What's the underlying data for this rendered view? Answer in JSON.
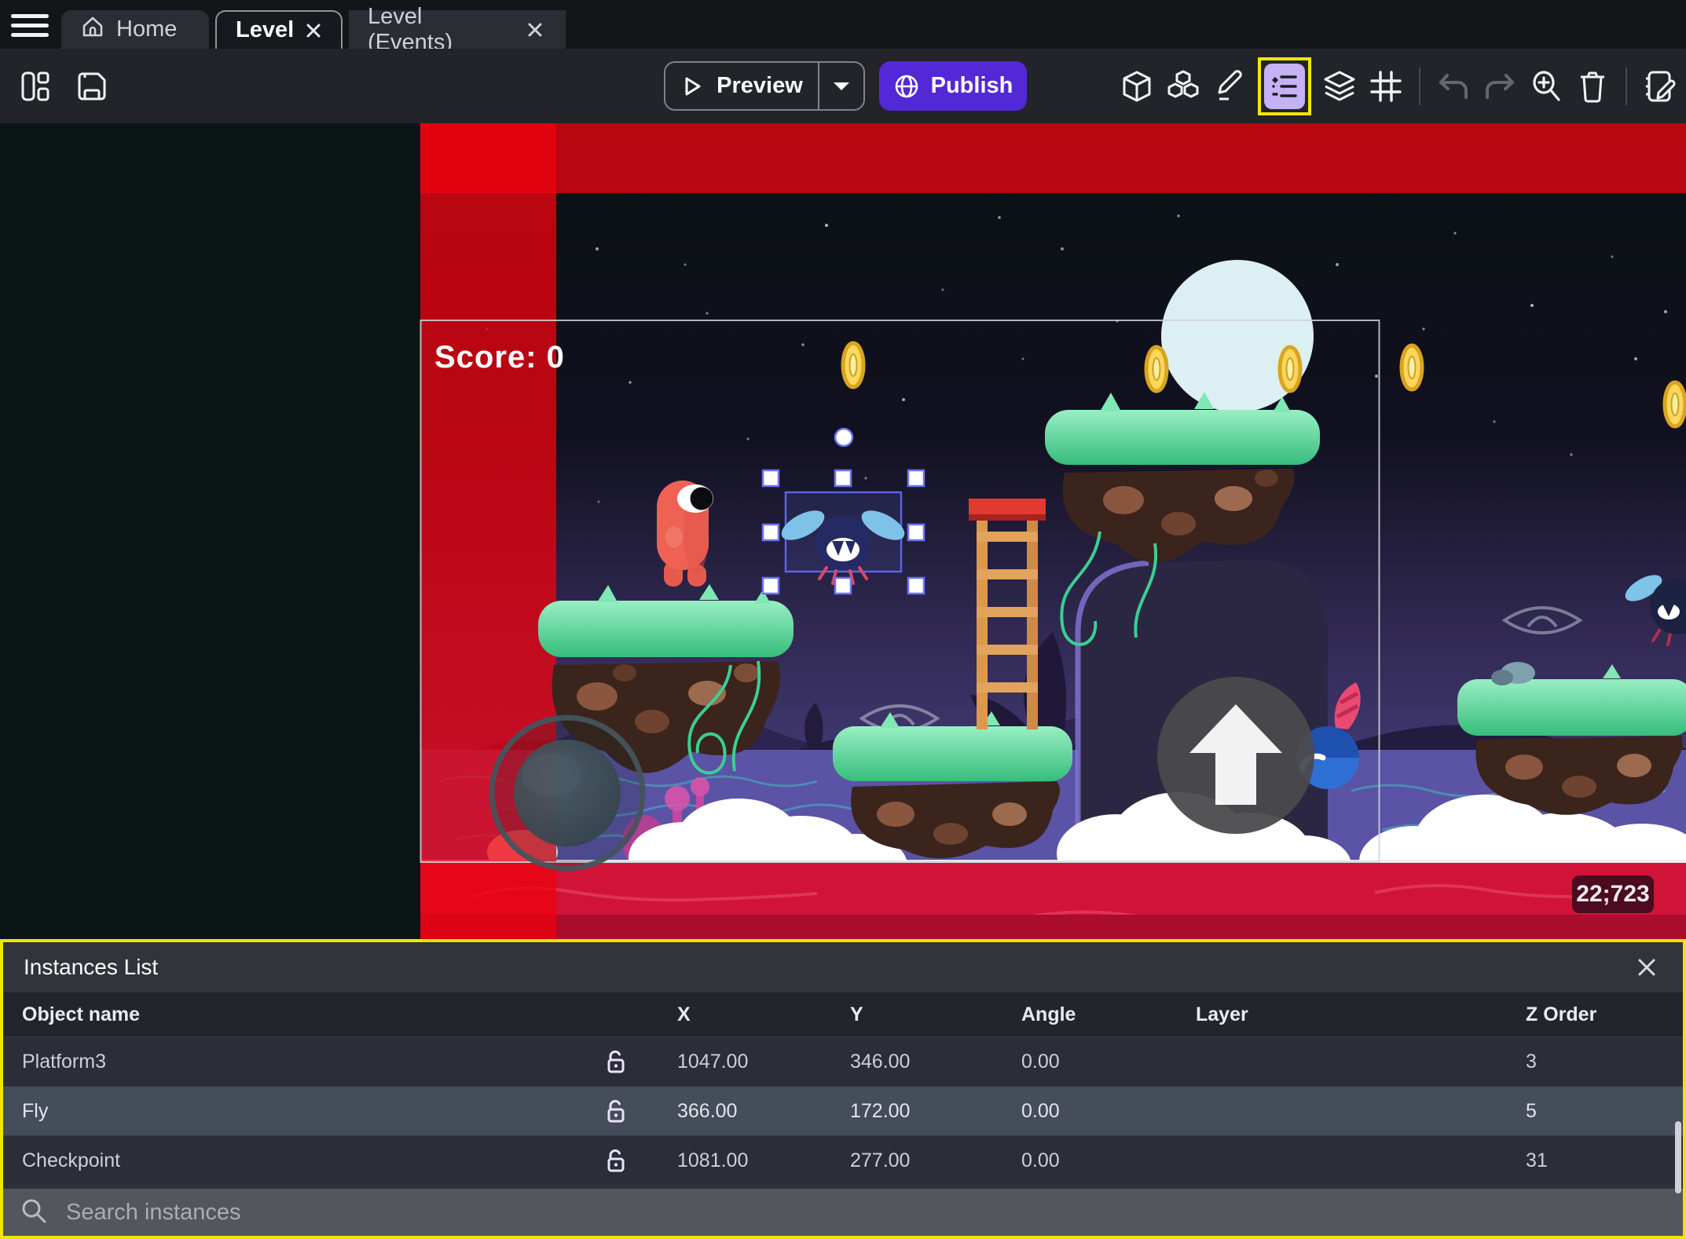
{
  "tabbar": {
    "menu_icon": "hamburger-icon",
    "tabs": [
      {
        "label": "Home",
        "icon": "home-icon",
        "active": false,
        "closable": false
      },
      {
        "label": "Level",
        "active": true,
        "closable": true
      },
      {
        "label": "Level (Events)",
        "active": false,
        "closable": true
      }
    ]
  },
  "toolbar": {
    "preview_label": "Preview",
    "publish_label": "Publish",
    "left_icons": [
      "layout-panels-icon",
      "save-icon"
    ],
    "right_icons": [
      "cube-icon",
      "cubes-icon",
      "pencil-icon",
      "instances-list-icon",
      "layers-icon",
      "grid-icon",
      "undo-icon",
      "redo-icon",
      "zoom-in-icon",
      "trash-icon",
      "notebook-edit-icon"
    ],
    "highlighted_icon": "instances-list-icon"
  },
  "scene": {
    "score_label": "Score: 0",
    "coord_badge": "22;723"
  },
  "panel": {
    "title": "Instances List",
    "close_icon": "close-icon",
    "columns": [
      "Object name",
      "X",
      "Y",
      "Angle",
      "Layer",
      "Z Order"
    ],
    "rows": [
      {
        "name": "Platform3",
        "x": "1047.00",
        "y": "346.00",
        "angle": "0.00",
        "layer": "",
        "z_order": "3",
        "selected": false,
        "lock_icon": "lock-open-icon"
      },
      {
        "name": "Fly",
        "x": "366.00",
        "y": "172.00",
        "angle": "0.00",
        "layer": "",
        "z_order": "5",
        "selected": true,
        "lock_icon": "lock-open-icon"
      },
      {
        "name": "Checkpoint",
        "x": "1081.00",
        "y": "277.00",
        "angle": "0.00",
        "layer": "",
        "z_order": "31",
        "selected": false,
        "lock_icon": "lock-open-icon"
      }
    ],
    "search_placeholder": "Search instances",
    "search_icon": "search-icon"
  },
  "colors": {
    "accent_purple": "#5328d6",
    "highlight_yellow": "#f2e400",
    "selection_blue": "#6b74f0",
    "icon_highlight_bg": "#c4b2f4",
    "selected_row_bg": "#454c5a",
    "band_red": "#e60414",
    "lava_red": "#d11338",
    "moon": "#dceff3"
  }
}
